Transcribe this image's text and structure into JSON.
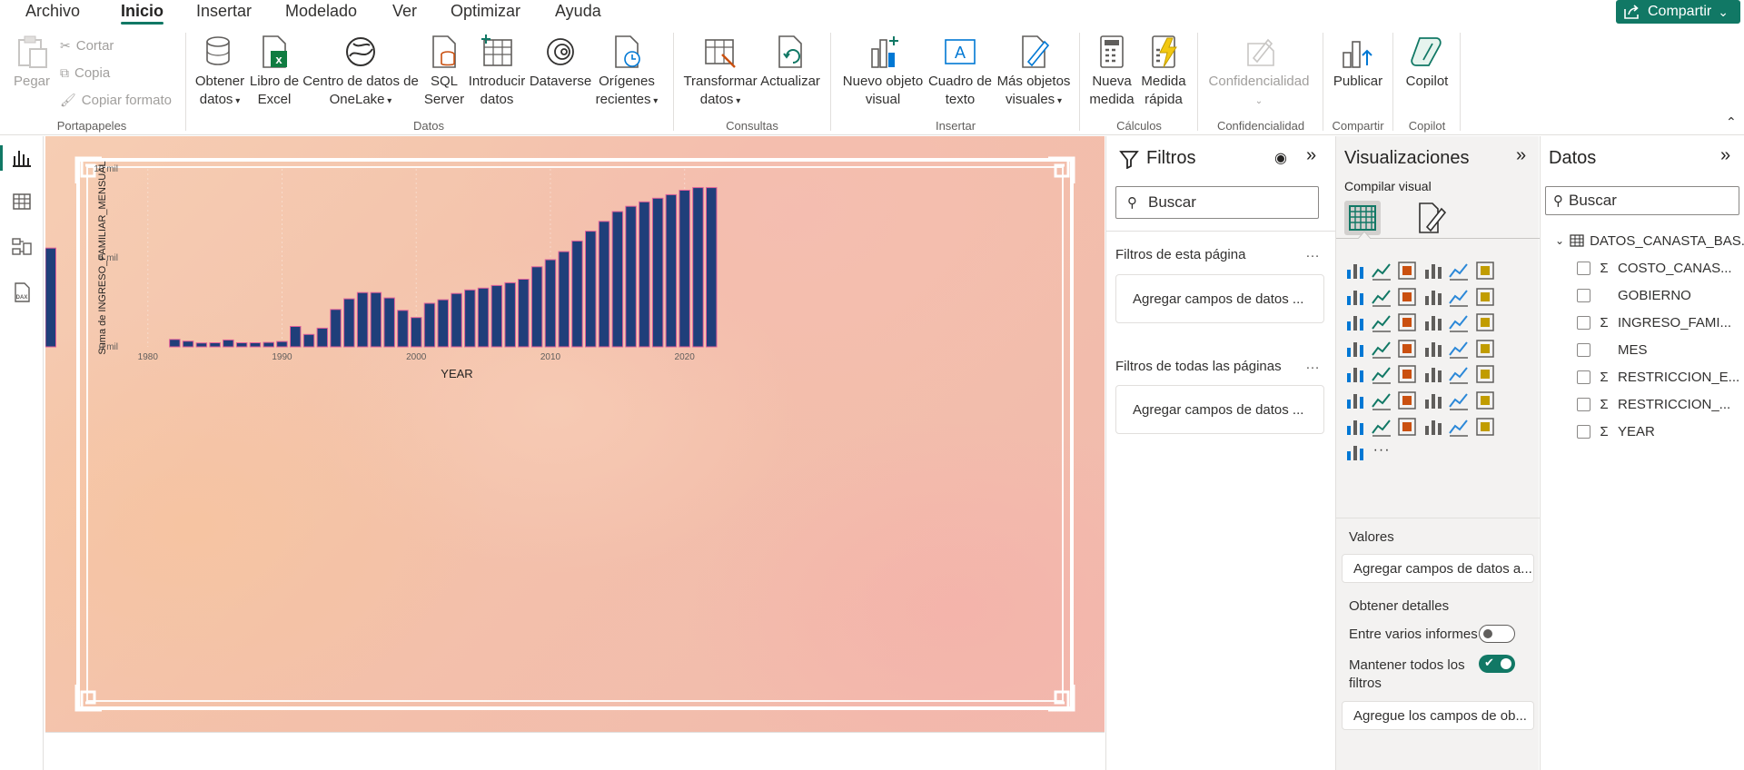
{
  "menu": {
    "items": [
      "Archivo",
      "Inicio",
      "Insertar",
      "Modelado",
      "Ver",
      "Optimizar",
      "Ayuda"
    ],
    "active": "Inicio",
    "share_label": "Compartir"
  },
  "ribbon": {
    "portapapeles": {
      "paste": "Pegar",
      "cut": "Cortar",
      "copy": "Copia",
      "format_painter": "Copiar formato",
      "group": "Portapapeles"
    },
    "datos": {
      "get_data": [
        "Obtener",
        "datos"
      ],
      "excel": [
        "Libro de",
        "Excel"
      ],
      "onelake": [
        "Centro de datos de",
        "OneLake"
      ],
      "sql": [
        "SQL",
        "Server"
      ],
      "enter_data": [
        "Introducir",
        "datos"
      ],
      "dataverse": "Dataverse",
      "recent": [
        "Orígenes",
        "recientes"
      ],
      "group": "Datos"
    },
    "consultas": {
      "transform": [
        "Transformar",
        "datos"
      ],
      "refresh": "Actualizar",
      "group": "Consultas"
    },
    "insertar": {
      "new_visual": [
        "Nuevo objeto",
        "visual"
      ],
      "textbox": [
        "Cuadro de",
        "texto"
      ],
      "more_visuals": [
        "Más objetos",
        "visuales"
      ],
      "group": "Insertar"
    },
    "calculos": {
      "new_measure": [
        "Nueva",
        "medida"
      ],
      "quick_measure": [
        "Medida",
        "rápida"
      ],
      "group": "Cálculos"
    },
    "confidencialidad": {
      "label": "Confidencialidad",
      "group": "Confidencialidad"
    },
    "compartir": {
      "publish": "Publicar",
      "group": "Compartir"
    },
    "copilot": {
      "label": "Copilot",
      "group": "Copilot"
    }
  },
  "filters_pane": {
    "title": "Filtros",
    "search_placeholder": "Buscar",
    "page_filters": "Filtros de esta página",
    "all_pages_filters": "Filtros de todas las páginas",
    "dropzone": "Agregar campos de datos ..."
  },
  "viz_pane": {
    "title": "Visualizaciones",
    "build_visual": "Compilar visual",
    "values_label": "Valores",
    "values_dropzone": "Agregar campos de datos a...",
    "drillthrough_label": "Obtener detalles",
    "cross_report": "Entre varios informes",
    "keep_filters": [
      "Mantener todos los",
      "filtros"
    ],
    "drill_dropzone": "Agregue los campos de ob...",
    "more": "···"
  },
  "data_pane": {
    "title": "Datos",
    "search_placeholder": "Buscar",
    "table": "DATOS_CANASTA_BAS...",
    "fields": [
      {
        "name": "COSTO_CANAS...",
        "sigma": true
      },
      {
        "name": "GOBIERNO",
        "sigma": false
      },
      {
        "name": "INGRESO_FAMI...",
        "sigma": true
      },
      {
        "name": "MES",
        "sigma": false
      },
      {
        "name": "RESTRICCION_E...",
        "sigma": true
      },
      {
        "name": "RESTRICCION_...",
        "sigma": true
      },
      {
        "name": "YEAR",
        "sigma": true
      }
    ]
  },
  "colors": {
    "accent": "#117865",
    "bar_fill": "#1f3f7a",
    "bar_stroke": "#e0609a"
  },
  "chart_data": {
    "type": "bar",
    "title": "",
    "xlabel": "YEAR",
    "ylabel": "Suma de INGRESO_FAMILIAR_MENSUAL",
    "y_tick_labels": [
      "0 mil",
      "5 mil",
      "10 mil"
    ],
    "y_ticks": [
      0,
      5000,
      10000
    ],
    "ylim": [
      0,
      10000
    ],
    "x_tick_labels": [
      "1980",
      "1990",
      "2000",
      "2010",
      "2020"
    ],
    "x_ticks": [
      1980,
      1990,
      2000,
      2010,
      2020
    ],
    "xlim": [
      1979,
      2023
    ],
    "grid": false,
    "x": [
      1982,
      1983,
      1984,
      1985,
      1986,
      1987,
      1988,
      1989,
      1990,
      1991,
      1992,
      1993,
      1994,
      1995,
      1996,
      1997,
      1998,
      1999,
      2000,
      2001,
      2002,
      2003,
      2004,
      2005,
      2006,
      2007,
      2008,
      2009,
      2010,
      2011,
      2012,
      2013,
      2014,
      2015,
      2016,
      2017,
      2018,
      2019,
      2020,
      2021,
      2022
    ],
    "values": [
      420,
      320,
      220,
      230,
      390,
      230,
      230,
      250,
      300,
      1150,
      700,
      1050,
      2100,
      2700,
      3050,
      3050,
      2750,
      2050,
      1650,
      2450,
      2650,
      3000,
      3200,
      3300,
      3450,
      3600,
      3800,
      4500,
      4900,
      5350,
      5950,
      6500,
      7050,
      7600,
      7900,
      8150,
      8350,
      8550,
      8800,
      8950,
      8950,
      5550
    ]
  }
}
